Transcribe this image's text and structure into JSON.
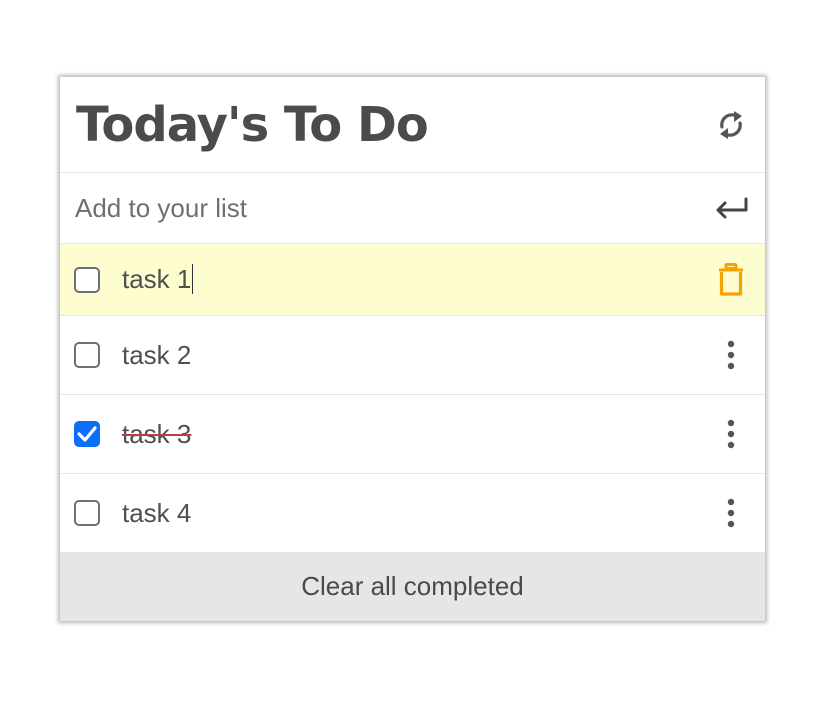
{
  "header": {
    "title": "Today's To Do",
    "refresh_icon": "refresh-icon"
  },
  "add": {
    "placeholder": "Add to your list",
    "value": "",
    "enter_icon": "enter-icon"
  },
  "tasks": [
    {
      "label": "task 1",
      "checked": false,
      "editing": true,
      "action_icon": "trash-icon",
      "highlight_color": "#fefdd0",
      "icon_color": "#f5a300"
    },
    {
      "label": "task 2",
      "checked": false,
      "editing": false,
      "action_icon": "more-vertical-icon"
    },
    {
      "label": "task 3",
      "checked": true,
      "editing": false,
      "action_icon": "more-vertical-icon"
    },
    {
      "label": "task 4",
      "checked": false,
      "editing": false,
      "action_icon": "more-vertical-icon"
    }
  ],
  "footer": {
    "clear_label": "Clear all completed"
  },
  "colors": {
    "checkbox_checked": "#0b6ff7",
    "strike": "#c0394a",
    "footer_bg": "#e6e6e6",
    "text": "#4f4f4f"
  }
}
